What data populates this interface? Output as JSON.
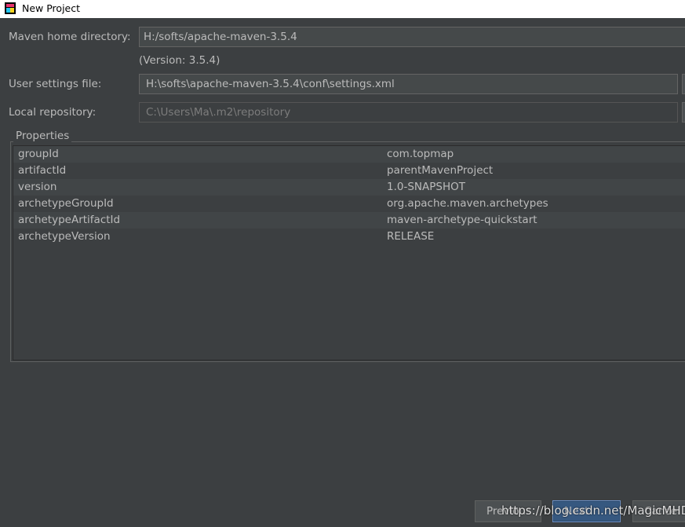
{
  "window": {
    "title": "New Project",
    "icon": "intellij-app-icon"
  },
  "maven_home": {
    "label": "Maven home directory:",
    "value": "H:/softs/apache-maven-3.5.4",
    "version": "(Version: 3.5.4)"
  },
  "user_settings": {
    "label": "User settings file:",
    "value": "H:\\softs\\apache-maven-3.5.4\\conf\\settings.xml"
  },
  "local_repo": {
    "label": "Local repository:",
    "value": "C:\\Users\\Ma\\.m2\\repository"
  },
  "properties": {
    "title": "Properties",
    "rows": [
      {
        "key": "groupId",
        "value": "com.topmap"
      },
      {
        "key": "artifactId",
        "value": "parentMavenProject"
      },
      {
        "key": "version",
        "value": "1.0-SNAPSHOT"
      },
      {
        "key": "archetypeGroupId",
        "value": "org.apache.maven.archetypes"
      },
      {
        "key": "archetypeArtifactId",
        "value": "maven-archetype-quickstart"
      },
      {
        "key": "archetypeVersion",
        "value": "RELEASE"
      }
    ]
  },
  "buttons": {
    "previous": "Previous",
    "next": "Next",
    "cancel": "Cancel"
  },
  "watermark": "https://blog.csdn.net/MagicMHD"
}
